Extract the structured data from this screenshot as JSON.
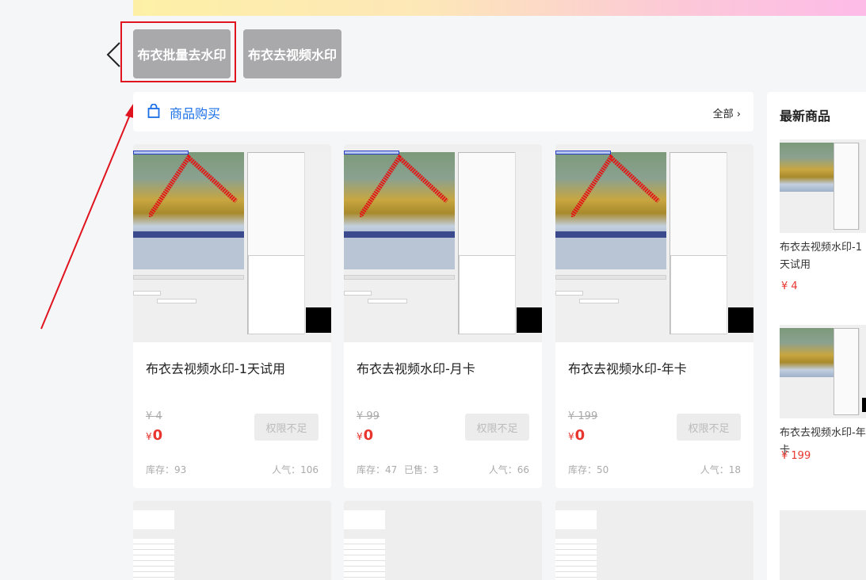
{
  "categories": [
    {
      "label": "布衣批量去水印",
      "highlighted": true
    },
    {
      "label": "布衣去视频水印",
      "highlighted": false
    }
  ],
  "section": {
    "title": "商品购买",
    "more_label": "全部 ›"
  },
  "products": [
    {
      "name": "布衣去视频水印-1天试用",
      "original_price": "¥ 4",
      "currency": "¥",
      "price": "0",
      "button_label": "权限不足",
      "stock": "库存：93",
      "sold": "",
      "popularity": "人气：106"
    },
    {
      "name": "布衣去视频水印-月卡",
      "original_price": "¥ 99",
      "currency": "¥",
      "price": "0",
      "button_label": "权限不足",
      "stock": "库存：47",
      "sold": "已售：3",
      "popularity": "人气：66"
    },
    {
      "name": "布衣去视频水印-年卡",
      "original_price": "¥ 199",
      "currency": "¥",
      "price": "0",
      "button_label": "权限不足",
      "stock": "库存：50",
      "sold": "",
      "popularity": "人气：18"
    }
  ],
  "latest": {
    "title": "最新商品",
    "items": [
      {
        "name": "布衣去视频水印-1天试用",
        "price": "¥ 4"
      },
      {
        "name": "布衣去视频水印-年卡",
        "price": "¥ 199"
      }
    ]
  },
  "colors": {
    "accent": "#1a6fe8",
    "price": "#e8352e",
    "category_button": "#a9a9ab",
    "annotation": "#e0141e"
  },
  "icons": {
    "back": "chevron-left-icon",
    "section": "shopping-bag-icon"
  }
}
